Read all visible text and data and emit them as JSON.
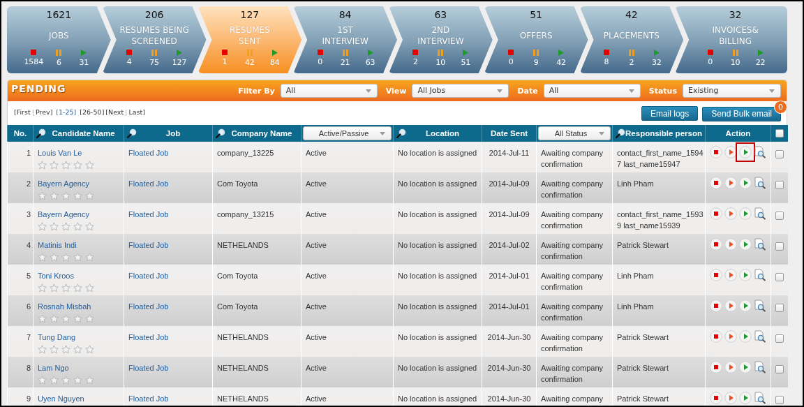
{
  "pipeline": [
    {
      "count": "1621",
      "label": "JOBS",
      "stopped": "1584",
      "paused": "6",
      "active": "31",
      "selected": false
    },
    {
      "count": "206",
      "label": "RESUMES BEING\nSCREENED",
      "stopped": "4",
      "paused": "75",
      "active": "127",
      "selected": false
    },
    {
      "count": "127",
      "label": "RESUMES\nSENT",
      "stopped": "1",
      "paused": "42",
      "active": "84",
      "selected": true
    },
    {
      "count": "84",
      "label": "1ST\nINTERVIEW",
      "stopped": "0",
      "paused": "21",
      "active": "63",
      "selected": false
    },
    {
      "count": "63",
      "label": "2ND\nINTERVIEW",
      "stopped": "2",
      "paused": "10",
      "active": "51",
      "selected": false
    },
    {
      "count": "51",
      "label": "OFFERS",
      "stopped": "0",
      "paused": "9",
      "active": "42",
      "selected": false
    },
    {
      "count": "42",
      "label": "PLACEMENTS",
      "stopped": "8",
      "paused": "2",
      "active": "32",
      "selected": false
    },
    {
      "count": "32",
      "label": "INVOICES&\nBILLING",
      "stopped": "0",
      "paused": "10",
      "active": "22",
      "selected": false
    }
  ],
  "panel": {
    "title": "PENDING",
    "filters": [
      {
        "label": "Filter By",
        "value": "All"
      },
      {
        "label": "View",
        "value": "All Jobs"
      },
      {
        "label": "Date",
        "value": "All"
      },
      {
        "label": "Status",
        "value": "Existing"
      }
    ]
  },
  "pagination": [
    {
      "text": "[First",
      "kind": "link",
      "selected": false
    },
    {
      "text": "|",
      "kind": "separator"
    },
    {
      "text": "Prev]",
      "kind": "link",
      "selected": false
    },
    {
      "text": "[1-25]",
      "kind": "link",
      "selected": true
    },
    {
      "text": "[26-50]",
      "kind": "link",
      "selected": false
    },
    {
      "text": "[Next",
      "kind": "link",
      "selected": false
    },
    {
      "text": "|",
      "kind": "separator"
    },
    {
      "text": "Last]",
      "kind": "link",
      "selected": false
    }
  ],
  "buttons": [
    {
      "label": "Email logs"
    },
    {
      "label": "Send Bulk email",
      "badge": "0"
    }
  ],
  "table": {
    "columns": [
      {
        "label": "No.",
        "kind": "plain"
      },
      {
        "label": "Candidate Name",
        "kind": "search"
      },
      {
        "label": "Job",
        "kind": "search"
      },
      {
        "label": "Company Name",
        "kind": "search"
      },
      {
        "label": "Active/Passive",
        "kind": "dropdown"
      },
      {
        "label": "Location",
        "kind": "search"
      },
      {
        "label": "Date Sent",
        "kind": "plain"
      },
      {
        "label": "All Status",
        "kind": "dropdown"
      },
      {
        "label": "Responsible person",
        "kind": "search"
      },
      {
        "label": "Action",
        "kind": "plain"
      },
      {
        "kind": "checkbox",
        "checked": false
      }
    ],
    "rows": [
      {
        "no": "1",
        "candidate": "Louis Van Le",
        "stars": 0,
        "job": "Floated Job",
        "company": "company_13225",
        "activity": "Active",
        "location": "No location is assigned",
        "date_sent": "2014-Jul-11",
        "status": "Awaiting company confirmation",
        "responsible": "contact_first_name_15947 last_name15947",
        "play_highlighted": true,
        "checked": false
      },
      {
        "no": "2",
        "candidate": "Bayern Agency",
        "stars": 0,
        "job": "Floated Job",
        "company": "Com Toyota",
        "activity": "Active",
        "location": "No location is assigned",
        "date_sent": "2014-Jul-09",
        "status": "Awaiting company confirmation",
        "responsible": "Linh Pham",
        "play_highlighted": false,
        "checked": false
      },
      {
        "no": "3",
        "candidate": "Bayern Agency",
        "stars": 0,
        "job": "Floated Job",
        "company": "company_13215",
        "activity": "Active",
        "location": "No location is assigned",
        "date_sent": "2014-Jul-09",
        "status": "Awaiting company confirmation",
        "responsible": "contact_first_name_15939 last_name15939",
        "play_highlighted": false,
        "checked": false
      },
      {
        "no": "4",
        "candidate": "Matinis Indi",
        "stars": 0,
        "job": "Floated Job",
        "company": "NETHELANDS",
        "activity": "Active",
        "location": "No location is assigned",
        "date_sent": "2014-Jul-02",
        "status": "Awaiting company confirmation",
        "responsible": "Patrick Stewart",
        "play_highlighted": false,
        "checked": false
      },
      {
        "no": "5",
        "candidate": "Toni Kroos",
        "stars": 0,
        "job": "Floated Job",
        "company": "Com Toyota",
        "activity": "Active",
        "location": "No location is assigned",
        "date_sent": "2014-Jul-01",
        "status": "Awaiting company confirmation",
        "responsible": "Linh Pham",
        "play_highlighted": false,
        "checked": false
      },
      {
        "no": "6",
        "candidate": "Rosnah Misbah",
        "stars": 0,
        "job": "Floated Job",
        "company": "Com Toyota",
        "activity": "Active",
        "location": "No location is assigned",
        "date_sent": "2014-Jul-01",
        "status": "Awaiting company confirmation",
        "responsible": "Linh Pham",
        "play_highlighted": false,
        "checked": false
      },
      {
        "no": "7",
        "candidate": "Tung Dang",
        "stars": 0,
        "job": "Floated Job",
        "company": "NETHELANDS",
        "activity": "Active",
        "location": "No location is assigned",
        "date_sent": "2014-Jun-30",
        "status": "Awaiting company confirmation",
        "responsible": "Patrick Stewart",
        "play_highlighted": false,
        "checked": false
      },
      {
        "no": "8",
        "candidate": "Lam Ngo",
        "stars": 0,
        "job": "Floated Job",
        "company": "NETHELANDS",
        "activity": "Active",
        "location": "No location is assigned",
        "date_sent": "2014-Jun-30",
        "status": "Awaiting company confirmation",
        "responsible": "Patrick Stewart",
        "play_highlighted": false,
        "checked": false
      },
      {
        "no": "9",
        "candidate": "Uyen Nguyen",
        "job": "Floated Job",
        "company": "NETHELANDS",
        "activity": "Active",
        "location": "No location is assigned",
        "date_sent": "2014-Jun-30",
        "status": "Awaiting company",
        "responsible": "Patrick Stewart",
        "play_highlighted": false,
        "checked": false
      }
    ]
  }
}
